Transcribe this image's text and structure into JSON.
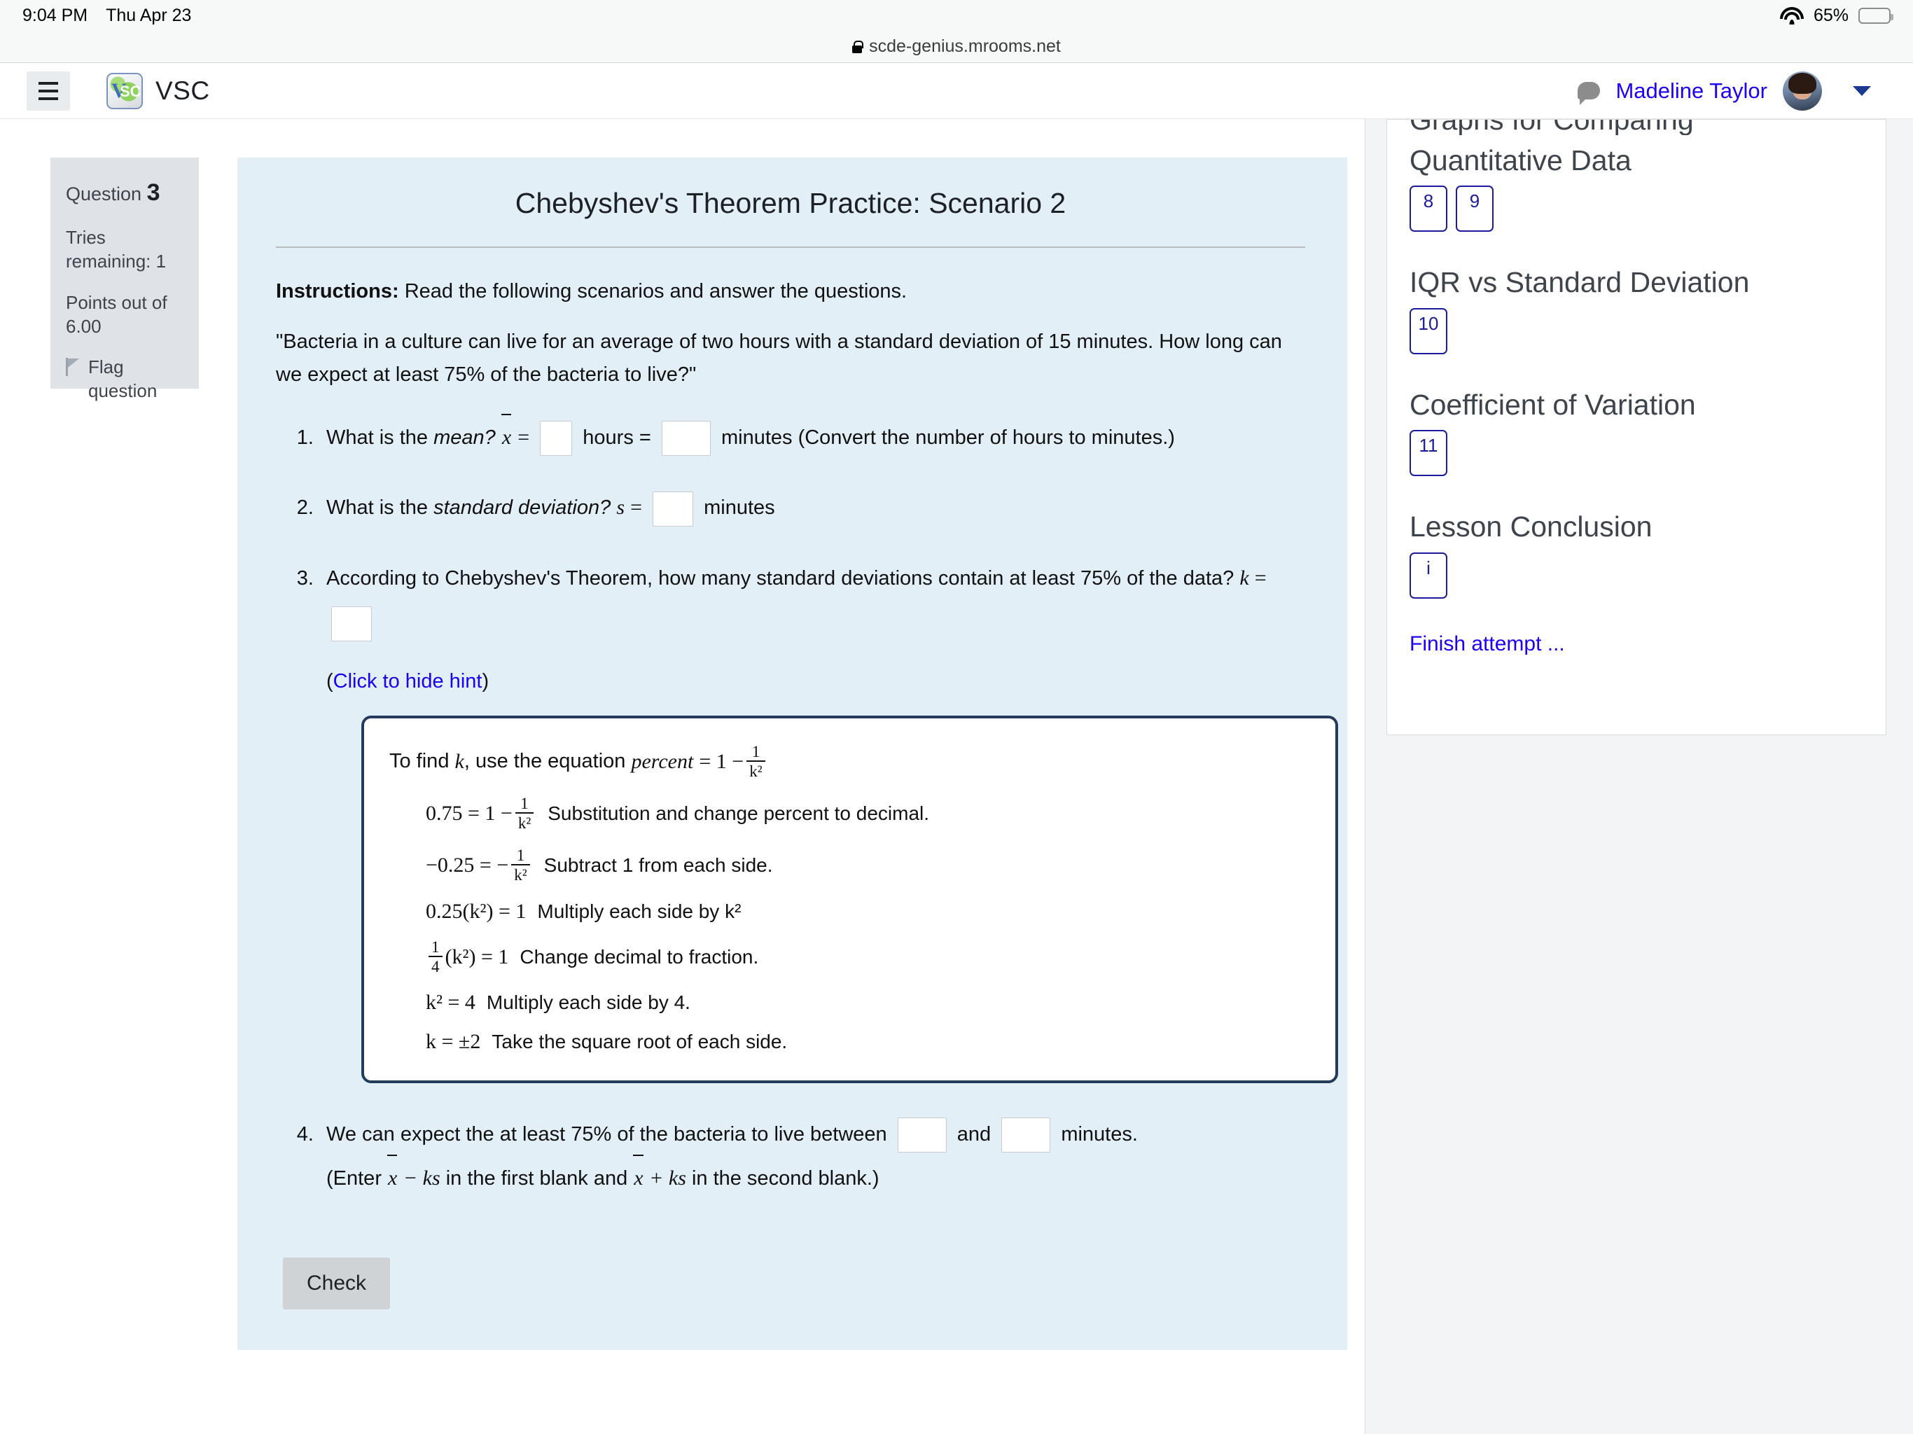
{
  "status_bar": {
    "time": "9:04 PM",
    "date": "Thu Apr 23",
    "battery_percent": "65%",
    "wifi_icon": "wifi-icon",
    "battery_icon": "battery-icon"
  },
  "browser": {
    "url": "scde-genius.mrooms.net",
    "lock_icon": "lock-icon"
  },
  "navbar": {
    "menu_icon": "hamburger-menu-icon",
    "brand": "VSC",
    "logo_icon": "vsc-logo-icon",
    "chat_icon": "chat-bubble-icon",
    "user_name": "Madeline Taylor",
    "avatar_icon": "user-avatar",
    "caret_icon": "chevron-down-icon"
  },
  "question_info": {
    "question_label": "Question",
    "question_number": "3",
    "tries_remaining": "Tries remaining: 1",
    "points": "Points out of 6.00",
    "flag_label": "Flag question",
    "flag_icon": "flag-icon"
  },
  "question": {
    "title": "Chebyshev's Theorem Practice: Scenario 2",
    "instructions_label": "Instructions:",
    "instructions_text": "Read the following scenarios and answer the questions.",
    "scenario": "\"Bacteria in a culture can live for an average of two hours with a standard deviation of 15 minutes. How long can we expect at least 75% of the bacteria to live?\"",
    "items": [
      {
        "lead": "What is the",
        "term": "mean?",
        "symbol": "x",
        "eq": "=",
        "unit1": "hours =",
        "unit2": "minutes (Convert the number of hours to minutes.)"
      },
      {
        "lead": "What is the",
        "term": "standard deviation?",
        "symbol": "s",
        "eq": "=",
        "unit1": "minutes"
      },
      {
        "text": "According to Chebyshev's Theorem, how many standard deviations contain at least 75% of the data?",
        "symbol": "k",
        "eq": "="
      },
      {
        "text_before": "We can expect the at least 75% of the bacteria to live between",
        "text_mid": "and",
        "text_after": "minutes.",
        "note_open": "(Enter",
        "note_expr1": "x − ks",
        "note_mid": "in the first blank and",
        "note_expr2": "x + ks",
        "note_close": "in the second blank.)"
      }
    ],
    "hint_toggle_open": "(",
    "hint_toggle_link": "Click to hide hint",
    "hint_toggle_close": ")",
    "hint": {
      "intro_a": "To find",
      "intro_k": "k",
      "intro_b": ", use the equation",
      "intro_percent": "percent",
      "intro_eq": "= 1 −",
      "lines": [
        {
          "lhs": "0.75 = 1 −",
          "frac_num": "1",
          "frac_den": "k²",
          "expl": "Substitution and change percent to decimal."
        },
        {
          "lhs": "−0.25 = −",
          "frac_num": "1",
          "frac_den": "k²",
          "expl": "Subtract 1 from each side."
        },
        {
          "lhs": "0.25(k²) = 1",
          "expl": "Multiply each side by k²"
        },
        {
          "lhs_frac_num": "1",
          "lhs_frac_den": "4",
          "lhs_after": "(k²) = 1",
          "expl": "Change decimal to fraction."
        },
        {
          "lhs": "k² = 4",
          "expl": "Multiply each side by 4."
        },
        {
          "lhs": "k = ±2",
          "expl": "Take the square root of each side."
        }
      ]
    },
    "check_button": "Check"
  },
  "sidebar": {
    "sections": [
      {
        "title": "Graphs for Comparing Quantitative Data",
        "buttons": [
          "8",
          "9"
        ]
      },
      {
        "title": "IQR vs Standard Deviation",
        "buttons": [
          "10"
        ]
      },
      {
        "title": "Coefficient of Variation",
        "buttons": [
          "11"
        ]
      },
      {
        "title": "Lesson Conclusion",
        "buttons": [
          "i"
        ]
      }
    ],
    "finish_link": "Finish attempt ..."
  },
  "colors": {
    "content_bg": "#e2eff6",
    "link": "#1b00f5",
    "hint_border": "#243b5e",
    "qinfo_bg": "#dfe3e8"
  }
}
